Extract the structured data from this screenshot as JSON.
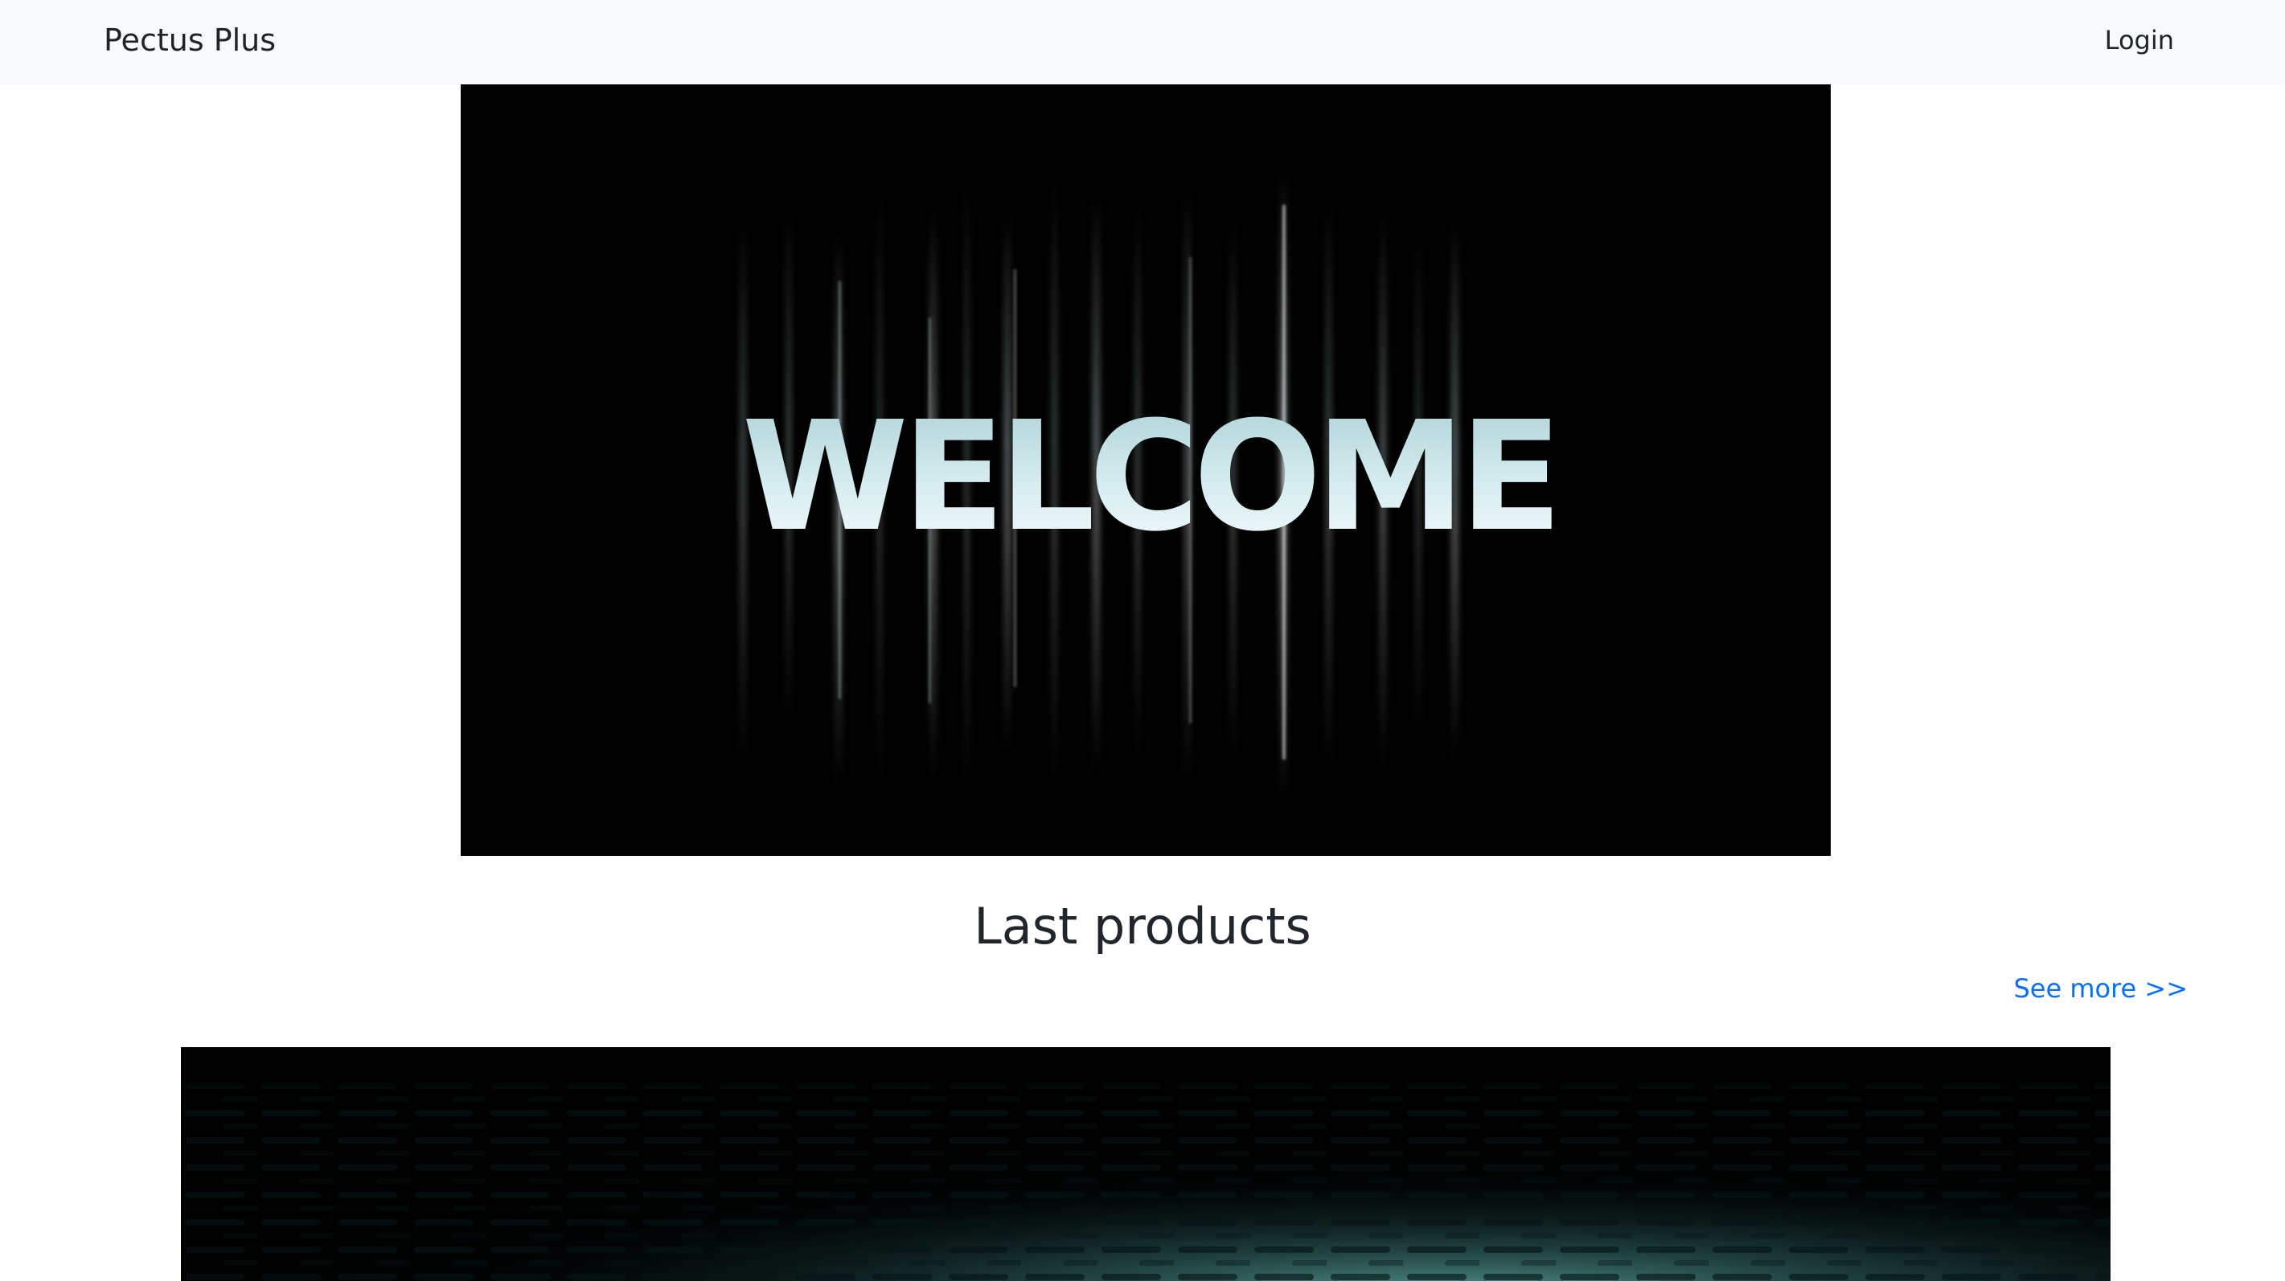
{
  "nav": {
    "brand": "Pectus Plus",
    "login_label": "Login"
  },
  "hero": {
    "image_text": "WELCOME",
    "icon": "welcome-banner-image"
  },
  "products": {
    "title": "Last products",
    "see_more_label": "See more >>",
    "first_card_icon": "teal-light-product-image"
  },
  "colors": {
    "link": "#0d6efd",
    "navbar_bg": "#f8f9fa",
    "text": "#212529",
    "hero_bg": "#000000",
    "accent_teal": "#5fa8a2"
  }
}
